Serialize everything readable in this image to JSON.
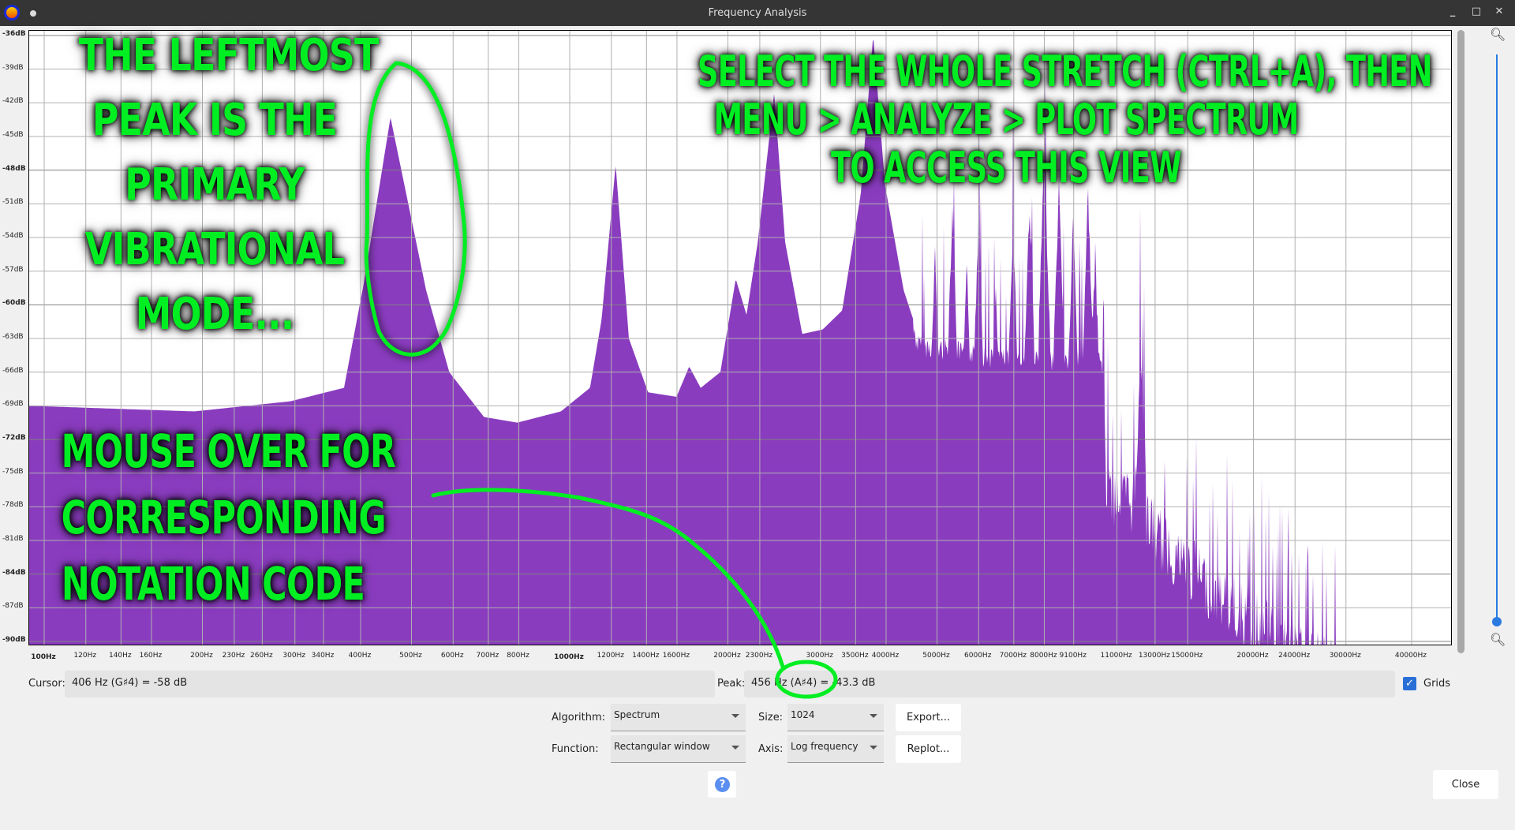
{
  "window": {
    "title": "Frequency Analysis",
    "minimize": "_",
    "maximize": "□",
    "close": "✕"
  },
  "chart_data": {
    "type": "area",
    "xscale": "log",
    "xlim_hz": [
      93.6,
      47900
    ],
    "ylim": [
      -90,
      -36
    ],
    "grid": true,
    "y_ticks": [
      "-36dB",
      "-39dB",
      "-42dB",
      "-45dB",
      "-48dB",
      "-51dB",
      "-54dB",
      "-57dB",
      "-60dB",
      "-63dB",
      "-66dB",
      "-69dB",
      "-72dB",
      "-75dB",
      "-78dB",
      "-81dB",
      "-84dB",
      "-87dB",
      "-90dB"
    ],
    "y_tick_values": [
      -36,
      -39,
      -42,
      -45,
      -48,
      -51,
      -54,
      -57,
      -60,
      -63,
      -66,
      -69,
      -72,
      -75,
      -78,
      -81,
      -84,
      -87,
      -90
    ],
    "x_ticks": [
      {
        "label": "100Hz",
        "hz": 100
      },
      {
        "label": "120Hz",
        "hz": 120
      },
      {
        "label": "140Hz",
        "hz": 140
      },
      {
        "label": "160Hz",
        "hz": 160
      },
      {
        "label": "200Hz",
        "hz": 200
      },
      {
        "label": "230Hz",
        "hz": 230
      },
      {
        "label": "260Hz",
        "hz": 260
      },
      {
        "label": "300Hz",
        "hz": 300
      },
      {
        "label": "340Hz",
        "hz": 340
      },
      {
        "label": "400Hz",
        "hz": 400
      },
      {
        "label": "500Hz",
        "hz": 500
      },
      {
        "label": "600Hz",
        "hz": 600
      },
      {
        "label": "700Hz",
        "hz": 700
      },
      {
        "label": "800Hz",
        "hz": 800
      },
      {
        "label": "1000Hz",
        "hz": 1000
      },
      {
        "label": "1200Hz",
        "hz": 1200
      },
      {
        "label": "1400Hz",
        "hz": 1400
      },
      {
        "label": "1600Hz",
        "hz": 1600
      },
      {
        "label": "2000Hz",
        "hz": 2000
      },
      {
        "label": "2300Hz",
        "hz": 2300
      },
      {
        "label": "3000Hz",
        "hz": 3000
      },
      {
        "label": "3500Hz",
        "hz": 3500
      },
      {
        "label": "4000Hz",
        "hz": 4000
      },
      {
        "label": "5000Hz",
        "hz": 5000
      },
      {
        "label": "6000Hz",
        "hz": 6000
      },
      {
        "label": "7000Hz",
        "hz": 7000
      },
      {
        "label": "8000Hz",
        "hz": 8000
      },
      {
        "label": "9100Hz",
        "hz": 9100
      },
      {
        "label": "11000Hz",
        "hz": 11000
      },
      {
        "label": "13000Hz",
        "hz": 13000
      },
      {
        "label": "15000Hz",
        "hz": 15000
      },
      {
        "label": "20000Hz",
        "hz": 20000
      },
      {
        "label": "24000Hz",
        "hz": 24000
      },
      {
        "label": "30000Hz",
        "hz": 30000
      },
      {
        "label": "40000Hz",
        "hz": 40000
      }
    ],
    "envelope": [
      [
        93.6,
        -69
      ],
      [
        193,
        -69.5
      ],
      [
        294,
        -68.6
      ],
      [
        372,
        -67.4
      ],
      [
        406,
        -58
      ],
      [
        456,
        -43.3
      ],
      [
        533,
        -58.7
      ],
      [
        590,
        -66
      ],
      [
        687,
        -70
      ],
      [
        795,
        -70.5
      ],
      [
        962,
        -69.5
      ],
      [
        1093,
        -67.4
      ],
      [
        1150,
        -61.3
      ],
      [
        1223,
        -47.5
      ],
      [
        1296,
        -63
      ],
      [
        1410,
        -67.8
      ],
      [
        1597,
        -68.2
      ],
      [
        1688,
        -65.5
      ],
      [
        1775,
        -67.4
      ],
      [
        1935,
        -66
      ],
      [
        2070,
        -57.7
      ],
      [
        2170,
        -60.9
      ],
      [
        2280,
        -54.4
      ],
      [
        2450,
        -41.1
      ],
      [
        2570,
        -54.4
      ],
      [
        2770,
        -62.6
      ],
      [
        3030,
        -62.2
      ],
      [
        3300,
        -60.5
      ],
      [
        3580,
        -50.1
      ],
      [
        3780,
        -36
      ],
      [
        3980,
        -49.3
      ],
      [
        4320,
        -58.7
      ],
      [
        4600,
        -62.6
      ],
      [
        7000,
        -64
      ],
      [
        10300,
        -64
      ],
      [
        10500,
        -73.4
      ],
      [
        12200,
        -75
      ],
      [
        13300,
        -78.1
      ],
      [
        16400,
        -82
      ],
      [
        20200,
        -85.4
      ],
      [
        25000,
        -88.5
      ],
      [
        28900,
        -90
      ]
    ],
    "spikes": [
      [
        4955,
        -54.4
      ],
      [
        5350,
        -50.1
      ],
      [
        5700,
        -55.3
      ],
      [
        6000,
        -51
      ],
      [
        6470,
        -57
      ],
      [
        6980,
        -51.9
      ],
      [
        7500,
        -49.7
      ],
      [
        8000,
        -45.8
      ],
      [
        8530,
        -48.4
      ],
      [
        9080,
        -51.4
      ],
      [
        9690,
        -48.9
      ],
      [
        10000,
        -54.4
      ],
      [
        12200,
        -59.2
      ]
    ],
    "fill_color": "#8a3cbf"
  },
  "annotations": {
    "left_note": [
      "THE LEFTMOST",
      "PEAK IS THE",
      "PRIMARY",
      "VIBRATIONAL",
      "MODE..."
    ],
    "right_note": [
      "SELECT THE WHOLE STRETCH (CTRL+A), THEN",
      "MENU > ANALYZE > PLOT SPECTRUM",
      "TO ACCESS THIS VIEW"
    ],
    "bottom_note": [
      "MOUSE OVER FOR",
      "CORRESPONDING",
      "NOTATION CODE"
    ],
    "color": "#00ee22"
  },
  "readouts": {
    "cursor_label": "Cursor:",
    "cursor_value": "406 Hz (G♯4) = -58 dB",
    "peak_label": "Peak:",
    "peak_value": "456 Hz (A♯4) = -43.3 dB",
    "grids_label": "Grids",
    "grids_checked": true
  },
  "controls": {
    "algorithm_label": "Algorithm:",
    "algorithm_value": "Spectrum",
    "size_label": "Size:",
    "size_value": "1024",
    "function_label": "Function:",
    "function_value": "Rectangular window",
    "axis_label": "Axis:",
    "axis_value": "Log frequency",
    "export": "Export...",
    "replot": "Replot...",
    "help": "?",
    "close": "Close"
  }
}
